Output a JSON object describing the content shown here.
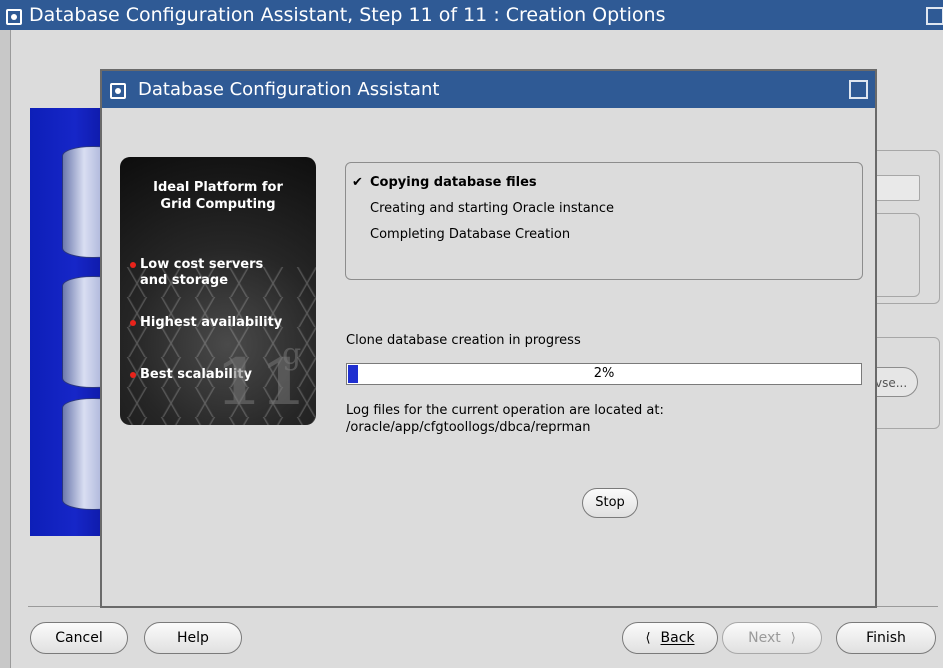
{
  "window": {
    "title": "Database Configuration Assistant, Step 11 of 11 : Creation Options"
  },
  "background": {
    "browse_fragment": "vse..."
  },
  "nav": {
    "cancel": "Cancel",
    "help": "Help",
    "back": "Back",
    "next": "Next",
    "finish": "Finish"
  },
  "dialog": {
    "title": "Database Configuration Assistant",
    "promo": {
      "heading_line1": "Ideal Platform for",
      "heading_line2": "Grid Computing",
      "bullets": [
        {
          "line1": "Low cost servers",
          "line2": "and storage"
        },
        {
          "line1": "Highest availability",
          "line2": ""
        },
        {
          "line1": "Best scalability",
          "line2": ""
        }
      ],
      "version_big": "11",
      "version_small": "g"
    },
    "steps": [
      {
        "label": "Copying database files",
        "done": true,
        "mark": "✔"
      },
      {
        "label": "Creating and starting Oracle instance",
        "done": false
      },
      {
        "label": "Completing Database Creation",
        "done": false
      }
    ],
    "status": "Clone database creation in progress",
    "progress": {
      "value": 0.02,
      "text": "2%"
    },
    "log_line1": "Log files for the current operation are located at:",
    "log_line2": "/oracle/app/cfgtoollogs/dbca/reprman",
    "stop": "Stop"
  }
}
